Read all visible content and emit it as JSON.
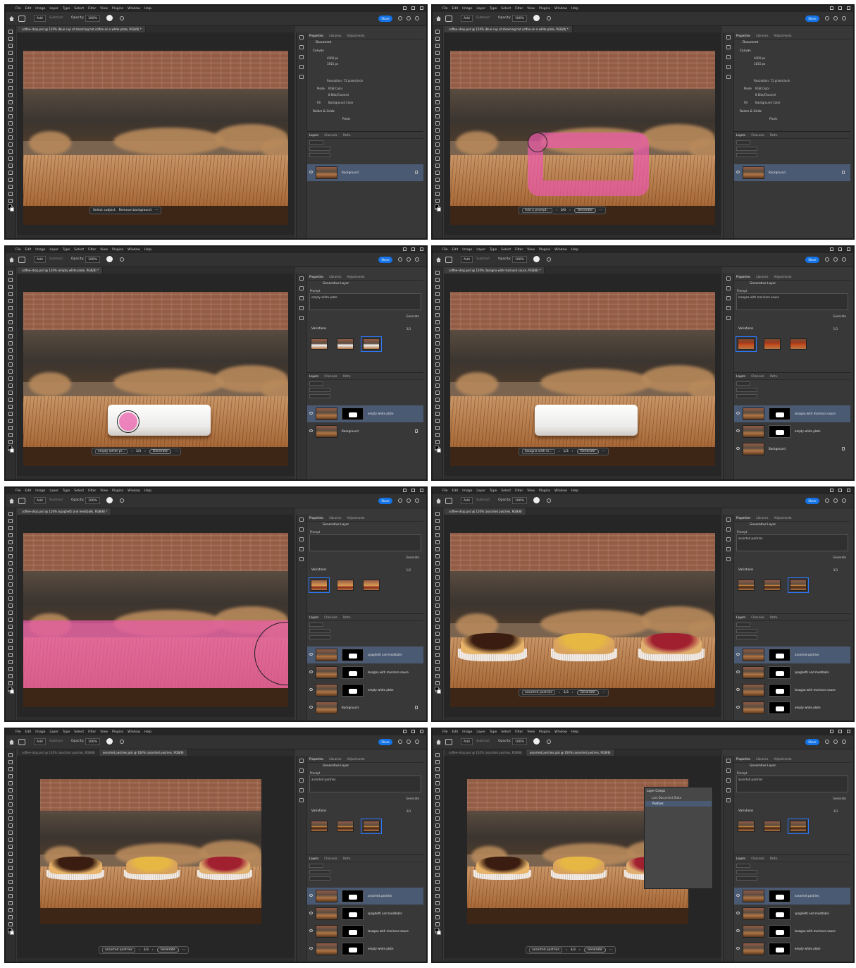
{
  "menu": [
    "File",
    "Edit",
    "Image",
    "Layer",
    "Type",
    "Select",
    "Filter",
    "View",
    "Plugins",
    "Window",
    "Help"
  ],
  "options": {
    "mode": "Add",
    "mode2": "Subtract",
    "opacity_label": "Opacity:",
    "opacity_value": "100%",
    "share": "Share"
  },
  "panels": [
    {
      "doc_tab": "coffee-shop.psd @ 120% (blue cup of steaming hot coffee on a white plate, RGB/8) *",
      "panel_tabs": [
        "Properties",
        "Libraries",
        "Adjustments"
      ],
      "props": {
        "section": "Document",
        "canvas_label": "Canvas",
        "width": "4000 px",
        "height": "1815 px",
        "resolution": "Resolution: 72 pixels/inch",
        "mode_label": "Mode",
        "mode": "RGB Color",
        "bit_depth": "8 Bits/Channel",
        "fill_label": "Fill",
        "fill": "Background Color",
        "rulers": "Rulers & Grids",
        "units": "Pixels"
      },
      "layer_tabs": [
        "Layers",
        "Channels",
        "Paths"
      ],
      "layers": [
        {
          "name": "Background",
          "locked": true,
          "selected": true
        }
      ],
      "ctx": {
        "select_subject": "Select subject",
        "remove_bg": "Remove background"
      }
    },
    {
      "doc_tab": "coffee-shop.psd @ 120% (blue cup of steaming hot coffee on a white plate, RGB/8) *",
      "panel_tabs": [
        "Properties",
        "Libraries",
        "Adjustments"
      ],
      "props": {
        "section": "Document",
        "canvas_label": "Canvas",
        "width": "4000 px",
        "height": "1815 px",
        "resolution": "Resolution: 72 pixels/inch",
        "mode_label": "Mode",
        "mode": "RGB Color",
        "bit_depth": "8 Bits/Channel",
        "fill_label": "Fill",
        "fill": "Background Color",
        "rulers": "Rulers & Grids",
        "units": "Pixels"
      },
      "layer_tabs": [
        "Layers",
        "Channels",
        "Paths"
      ],
      "layers": [
        {
          "name": "Background",
          "locked": true,
          "selected": true
        }
      ],
      "ctx": {
        "prompt": "Add a prompt...",
        "counter": "0/0",
        "generate": "Generate"
      }
    },
    {
      "doc_tab": "coffee-shop.psd @ 120% (empty white plate, RGB/8) *",
      "panel_tabs": [
        "Properties",
        "Libraries",
        "Adjustments"
      ],
      "gen": {
        "title": "Generative Layer",
        "prompt_label": "Prompt",
        "prompt": "empty white plate",
        "generate": "Generate",
        "variations": "Variations",
        "count": "3/3"
      },
      "layer_tabs": [
        "Layers",
        "Channels",
        "Paths"
      ],
      "layers": [
        {
          "name": "empty white plate",
          "selected": true,
          "mask": true
        },
        {
          "name": "Background",
          "locked": true
        }
      ],
      "ctx": {
        "prompt": "empty white pl...",
        "counter": "3/3",
        "generate": "Generate"
      }
    },
    {
      "doc_tab": "coffee-shop.psd @ 120% (lasagna with marinara sauce, RGB/8) *",
      "panel_tabs": [
        "Properties",
        "Libraries",
        "Adjustments"
      ],
      "gen": {
        "title": "Generative Layer",
        "prompt_label": "Prompt",
        "prompt": "lasagna with marinara sauce",
        "generate": "Generate",
        "variations": "Variations",
        "count": "1/3"
      },
      "layer_tabs": [
        "Layers",
        "Channels",
        "Paths"
      ],
      "layers": [
        {
          "name": "lasagna with marinara sauce",
          "selected": true,
          "mask": true
        },
        {
          "name": "empty white plate",
          "mask": true
        },
        {
          "name": "Background",
          "locked": true
        }
      ],
      "ctx": {
        "prompt": "lasagna with m...",
        "counter": "1/3",
        "generate": "Generate"
      }
    },
    {
      "doc_tab": "coffee-shop.psd @ 120% (spaghetti and meatballs, RGB/8) *",
      "panel_tabs": [
        "Properties",
        "Libraries",
        "Adjustments"
      ],
      "gen": {
        "title": "Generative Layer",
        "prompt_label": "Prompt",
        "prompt": "",
        "generate": "Generate",
        "variations": "Variations",
        "count": "1/3"
      },
      "layer_tabs": [
        "Layers",
        "Channels",
        "Paths"
      ],
      "layers": [
        {
          "name": "spaghetti and meatballs",
          "selected": true,
          "mask": true
        },
        {
          "name": "lasagna with marinara sauce",
          "mask": true
        },
        {
          "name": "empty white plate",
          "mask": true
        },
        {
          "name": "Background",
          "locked": true
        }
      ],
      "ctx": null
    },
    {
      "doc_tab": "coffee-shop.psd @ 120% (assorted pastries, RGB/8)",
      "panel_tabs": [
        "Properties",
        "Libraries",
        "Adjustments"
      ],
      "gen": {
        "title": "Generative Layer",
        "prompt_label": "Prompt",
        "prompt": "assorted pastries",
        "generate": "Generate",
        "variations": "Variations",
        "count": "3/3"
      },
      "layer_tabs": [
        "Layers",
        "Channels",
        "Paths"
      ],
      "layers": [
        {
          "name": "assorted pastries",
          "selected": true,
          "mask": true
        },
        {
          "name": "spaghetti and meatballs",
          "mask": true
        },
        {
          "name": "lasagna with marinara sauce",
          "mask": true
        },
        {
          "name": "empty white plate",
          "mask": true
        }
      ],
      "ctx": {
        "prompt": "assorted pastries",
        "counter": "3/3",
        "generate": "Generate"
      }
    },
    {
      "doc_tab": "coffee-shop.psd @ 120% (assorted pastries, RGB/8)",
      "doc_tab2": "assorted pastries.psb @ 100% (assorted pastries, RGB/8)",
      "panel_tabs": [
        "Properties",
        "Libraries",
        "Adjustments"
      ],
      "gen": {
        "title": "Generative Layer",
        "prompt_label": "Prompt",
        "prompt": "assorted pastries",
        "generate": "Generate",
        "variations": "Variations",
        "count": "3/3"
      },
      "layer_tabs": [
        "Layers",
        "Channels",
        "Paths"
      ],
      "layers": [
        {
          "name": "assorted pastries",
          "selected": true,
          "mask": true
        },
        {
          "name": "spaghetti and meatballs",
          "mask": true
        },
        {
          "name": "lasagna with marinara sauce",
          "mask": true
        },
        {
          "name": "empty white plate",
          "mask": true
        }
      ],
      "ctx": {
        "prompt": "assorted pastries",
        "counter": "3/3",
        "generate": "Generate"
      }
    },
    {
      "doc_tab": "coffee-shop.psd @ 120% (assorted pastries, RGB/8)",
      "doc_tab2": "assorted pastries.psb @ 100% (assorted pastries, RGB/8)",
      "panel_tabs": [
        "Properties",
        "Libraries",
        "Adjustments"
      ],
      "gen": {
        "title": "Generative Layer",
        "prompt_label": "Prompt",
        "prompt": "assorted pastries",
        "generate": "Generate",
        "variations": "Variations",
        "count": "3/3"
      },
      "layer_tabs": [
        "Layers",
        "Channels",
        "Paths"
      ],
      "layers": [
        {
          "name": "assorted pastries",
          "selected": true,
          "mask": true
        },
        {
          "name": "spaghetti and meatballs",
          "mask": true
        },
        {
          "name": "lasagna with marinara sauce",
          "mask": true
        },
        {
          "name": "empty white plate",
          "mask": true
        }
      ],
      "ctx": {
        "prompt": "assorted pastries",
        "counter": "3/3",
        "generate": "Generate"
      },
      "layer_comps": {
        "title": "Layer Comps",
        "last_state": "Last Document State",
        "item": "Pastries"
      }
    }
  ],
  "colors": {
    "accent": "#1473e6",
    "paint": "#eb5aaa",
    "selection": "#4a5a73"
  }
}
